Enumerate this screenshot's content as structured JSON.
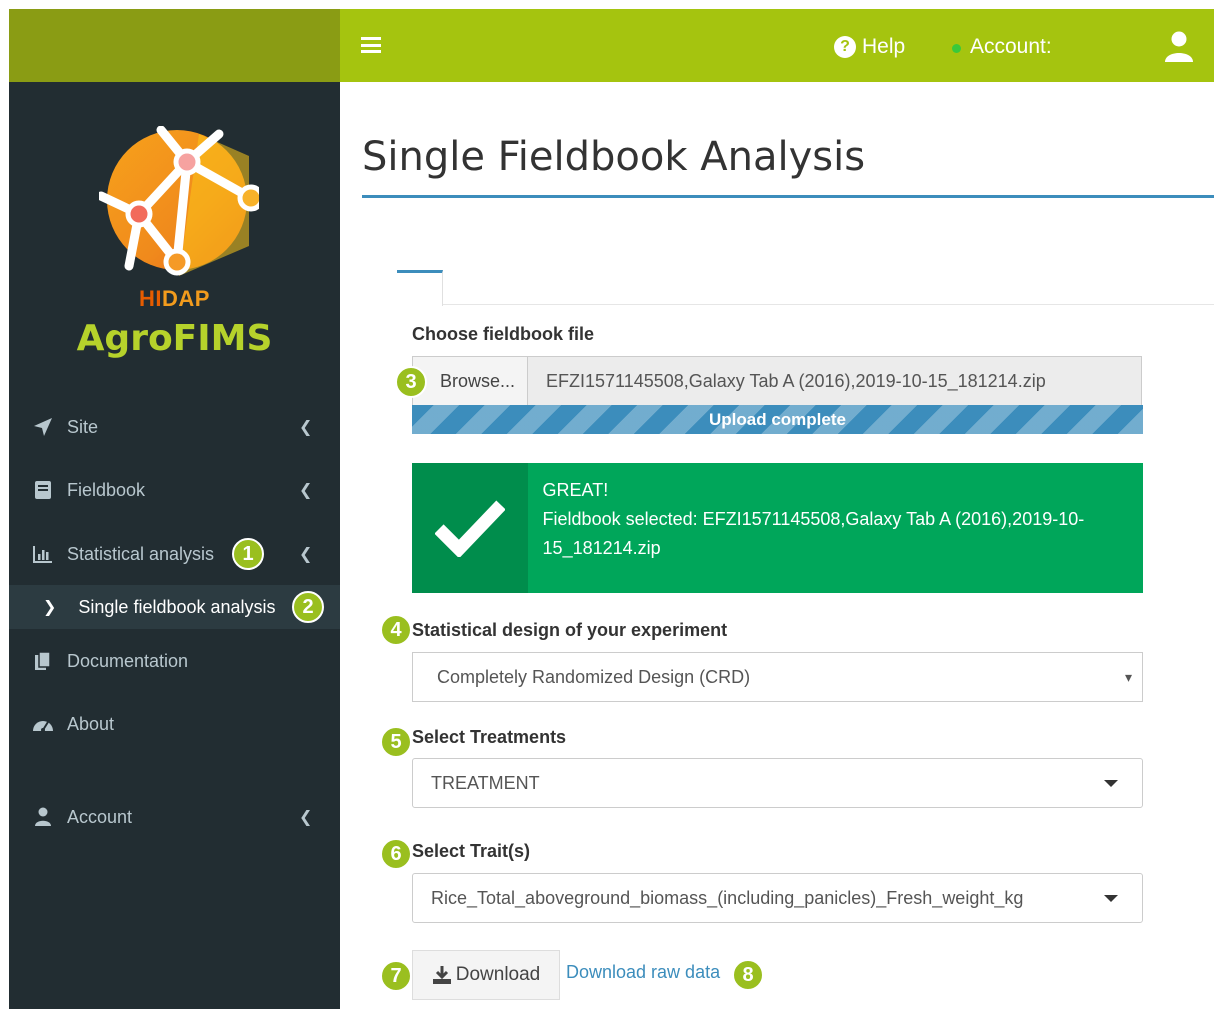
{
  "brand": {
    "hi": "HI",
    "dap": "DAP",
    "name": "AgroFIMS"
  },
  "topbar": {
    "help_label": "Help",
    "account_label": "Account:"
  },
  "sidebar": {
    "items": [
      {
        "label": "Site"
      },
      {
        "label": "Fieldbook"
      },
      {
        "label": "Statistical analysis"
      },
      {
        "label": "Documentation"
      },
      {
        "label": "About"
      },
      {
        "label": "Account"
      }
    ],
    "subitem": {
      "label": "Single fieldbook analysis"
    }
  },
  "badges": [
    "1",
    "2",
    "3",
    "4",
    "5",
    "6",
    "7",
    "8"
  ],
  "main": {
    "title": "Single Fieldbook Analysis",
    "file": {
      "label": "Choose fieldbook file",
      "browse_label": "Browse...",
      "filename": "EFZI1571145508,Galaxy Tab A (2016),2019-10-15_181214.zip",
      "progress_label": "Upload complete",
      "progress": 1.0
    },
    "alert": {
      "title": "GREAT!",
      "message": "Fieldbook selected: EFZI1571145508,Galaxy Tab A (2016),2019-10-15_181214.zip"
    },
    "design": {
      "label": "Statistical design of your experiment",
      "value": "Completely Randomized Design (CRD)"
    },
    "treatments": {
      "label": "Select Treatments",
      "value": "TREATMENT"
    },
    "traits": {
      "label": "Select Trait(s)",
      "value": "Rice_Total_aboveground_biomass_(including_panicles)_Fresh_weight_kg"
    },
    "download_label": "Download",
    "raw_link": "Download raw data"
  },
  "colors": {
    "topbar": "#a5c40f",
    "logo_bar": "#8a9c14",
    "sidebar": "#222d32",
    "accent": "#3c8dbc",
    "success": "#00a65a",
    "badge": "#9abf1f"
  }
}
